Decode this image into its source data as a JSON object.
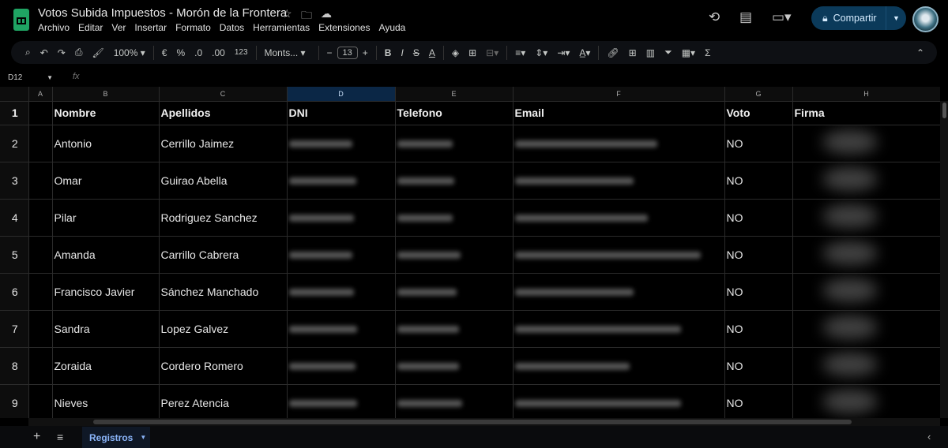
{
  "doc": {
    "title": "Votos Subida Impuestos - Morón de la Frontera"
  },
  "menu": [
    "Archivo",
    "Editar",
    "Ver",
    "Insertar",
    "Formato",
    "Datos",
    "Herramientas",
    "Extensiones",
    "Ayuda"
  ],
  "share": {
    "label": "Compartir"
  },
  "toolbar": {
    "zoom": "100%",
    "currency": "€",
    "percent": "%",
    "dec_less": ".0",
    "dec_more": ".00",
    "number_format": "123",
    "font": "Monts...",
    "font_size": "13",
    "bold": "B",
    "italic": "I",
    "strike": "S",
    "text_color": "A"
  },
  "namebox": "D12",
  "fx": "fx",
  "columns": [
    "A",
    "B",
    "C",
    "D",
    "E",
    "F",
    "G",
    "H"
  ],
  "header": [
    "Nombre",
    "Apellidos",
    "DNI",
    "Telefono",
    "Email",
    "Voto",
    "Firma"
  ],
  "rows": [
    {
      "n": "2",
      "nombre": "Antonio",
      "apellidos": "Cerrillo Jaimez",
      "voto": "NO"
    },
    {
      "n": "3",
      "nombre": "Omar",
      "apellidos": "Guirao Abella",
      "voto": "NO"
    },
    {
      "n": "4",
      "nombre": "Pilar",
      "apellidos": "Rodriguez Sanchez",
      "voto": "NO"
    },
    {
      "n": "5",
      "nombre": "Amanda",
      "apellidos": "Carrillo Cabrera",
      "voto": "NO"
    },
    {
      "n": "6",
      "nombre": "Francisco Javier",
      "apellidos": "Sánchez Manchado",
      "voto": "NO"
    },
    {
      "n": "7",
      "nombre": "Sandra",
      "apellidos": "Lopez Galvez",
      "voto": "NO"
    },
    {
      "n": "8",
      "nombre": "Zoraida",
      "apellidos": "Cordero Romero",
      "voto": "NO"
    },
    {
      "n": "9",
      "nombre": "Nieves",
      "apellidos": "Perez Atencia",
      "voto": "NO"
    }
  ],
  "sheet": {
    "tab": "Registros"
  }
}
